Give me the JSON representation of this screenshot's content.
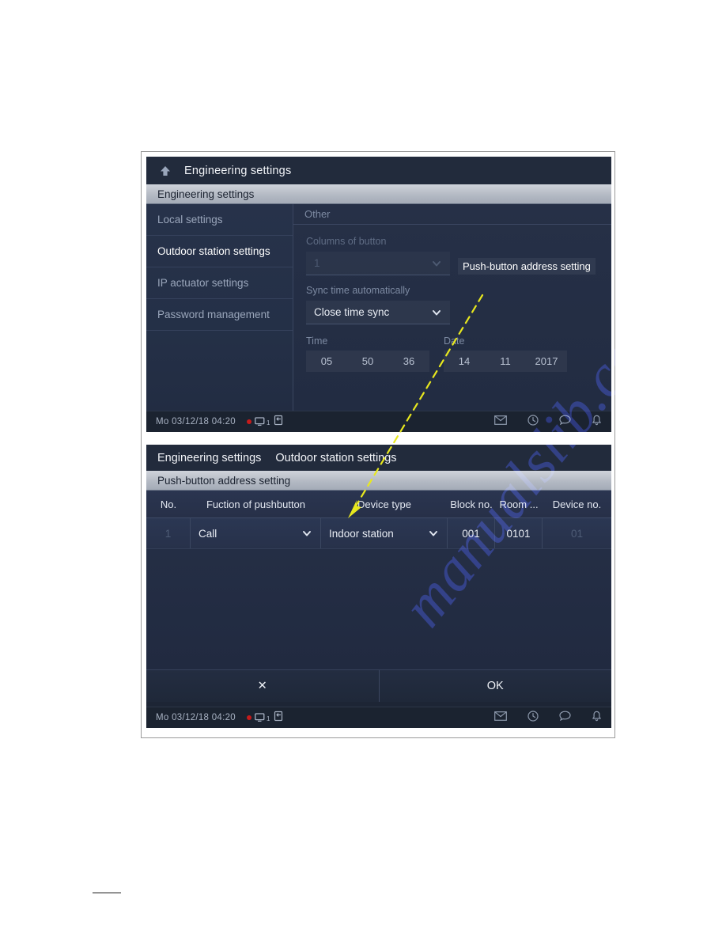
{
  "figure": {
    "watermark": "manualslib.com",
    "callout": {
      "label": "Push-button address setting"
    }
  },
  "top_panel": {
    "titlebar": {
      "back_icon": "back-arrow-icon",
      "title": "Engineering settings"
    },
    "section_bar": {
      "label": "Engineering settings"
    },
    "sidebar": {
      "items": [
        {
          "label": "Local settings",
          "active": false
        },
        {
          "label": "Outdoor station settings",
          "active": true
        },
        {
          "label": "IP actuator settings",
          "active": false
        },
        {
          "label": "Password management",
          "active": false
        }
      ]
    },
    "content": {
      "header": "Other",
      "columns_of_button": {
        "label": "Columns of button",
        "value": "1"
      },
      "sync_time": {
        "label": "Sync time automatically",
        "value": "Close time sync"
      },
      "time": {
        "label": "Time",
        "hour": "05",
        "minute": "50",
        "second": "36"
      },
      "date": {
        "label": "Date",
        "day": "14",
        "month": "11",
        "year": "2017"
      }
    },
    "statusbar": {
      "datetime": "Mo 03/12/18  04:20",
      "monitor_count": "1",
      "icons": [
        "record-dot-icon",
        "monitor-icon",
        "return-icon",
        "mail-icon",
        "history-icon",
        "message-icon",
        "bell-icon"
      ]
    }
  },
  "bottom_panel": {
    "breadcrumb": {
      "root": "Engineering settings",
      "current": "Outdoor station settings"
    },
    "section_bar": {
      "label": "Push-button address setting"
    },
    "table": {
      "headers": [
        "No.",
        "Fuction of pushbutton",
        "Device type",
        "Block no.",
        "Room ...",
        "Device no."
      ],
      "rows": [
        {
          "no": "1",
          "function": "Call",
          "device_type": "Indoor station",
          "block_no": "001",
          "room_no": "0101",
          "device_no": "01"
        }
      ]
    },
    "buttons": {
      "cancel": "✕",
      "ok": "OK"
    },
    "statusbar": {
      "datetime": "Mo 03/12/18  04:20",
      "monitor_count": "1"
    }
  },
  "colors": {
    "panel_bg": "#1d2535",
    "titlebar_bg": "#222b3c",
    "section_bar_bg": "#b4bac4",
    "accent_text": "#ffffff",
    "dim_text": "#7d8aa2",
    "callout_line": "#e8e81e",
    "watermark": "#2834be",
    "record_dot": "#c61b1b"
  }
}
